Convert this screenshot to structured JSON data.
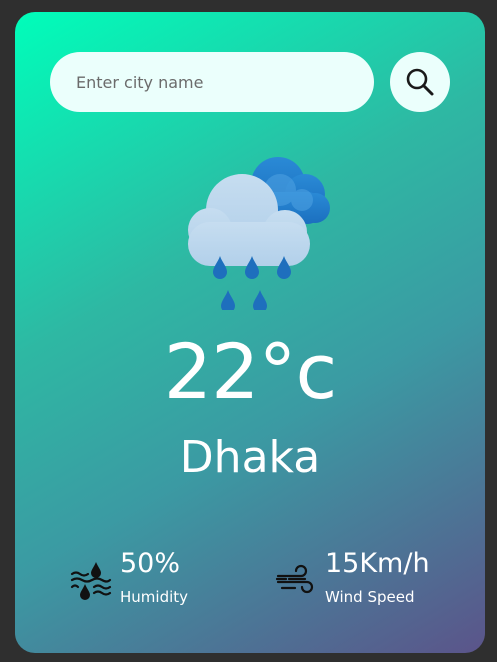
{
  "search": {
    "placeholder": "Enter city name",
    "button_icon": "search-icon"
  },
  "weather": {
    "icon": "rain-cloud-icon",
    "temperature": "22°c",
    "city": "Dhaka"
  },
  "details": {
    "humidity": {
      "value": "50%",
      "label": "Humidity",
      "icon": "humidity-icon"
    },
    "wind": {
      "value": "15Km/h",
      "label": "Wind Speed",
      "icon": "wind-icon"
    }
  },
  "colors": {
    "gradient_start": "#00feba",
    "gradient_end": "#5b548a",
    "page_background": "#2f2f2f",
    "input_background": "#ebfffc"
  }
}
